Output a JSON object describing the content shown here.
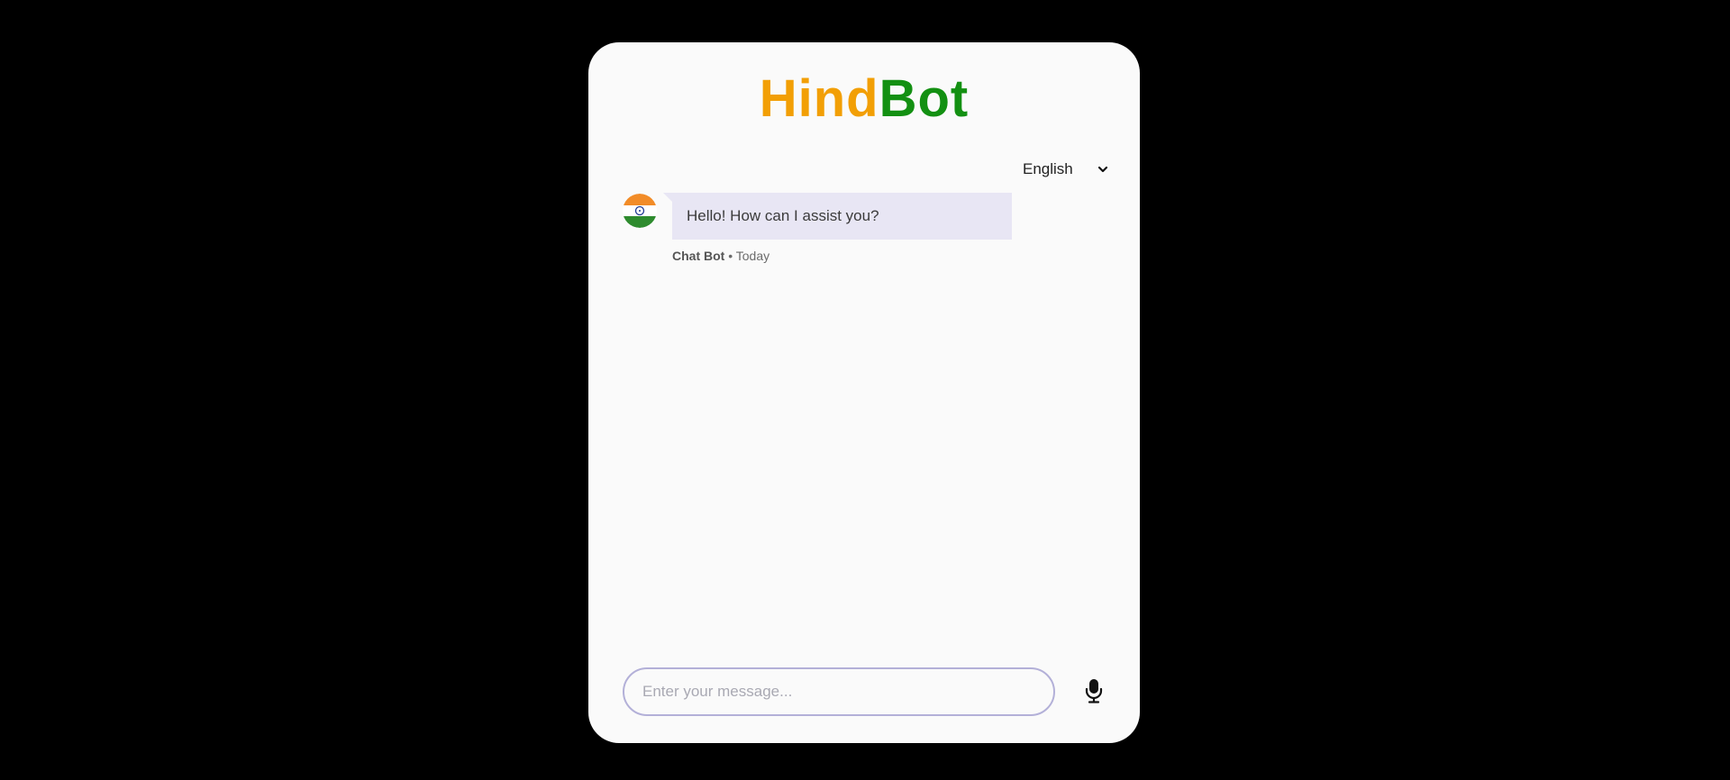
{
  "header": {
    "title_part1": "Hind",
    "title_part2": "Bot",
    "title_part1_color": "#f29f05",
    "title_part2_color": "#139012"
  },
  "language": {
    "selected": "English",
    "icon": "chevron-down-icon"
  },
  "messages": [
    {
      "text": "Hello! How can I assist you?",
      "sender": "Chat Bot",
      "separator": "•",
      "time": "Today",
      "avatar_icon": "india-flag-icon"
    }
  ],
  "composer": {
    "placeholder": "Enter your message...",
    "mic_icon": "microphone-icon"
  },
  "colors": {
    "background": "#000000",
    "card": "#fafafa",
    "bubble": "#e8e6f4",
    "input_border": "#b3b0d8"
  }
}
